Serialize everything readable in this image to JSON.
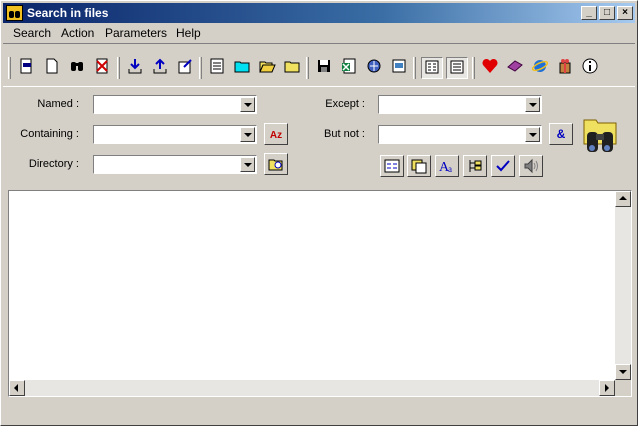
{
  "window": {
    "title": "Search in files"
  },
  "titlebar_buttons": {
    "minimize": "_",
    "maximize": "□",
    "close": "×"
  },
  "menu": {
    "items": [
      "Search",
      "Action",
      "Parameters",
      "Help"
    ]
  },
  "toolbar": {
    "icons": [
      "new-search-icon",
      "new-document-icon",
      "find-binoculars-icon",
      "clear-results-icon",
      "import-icon",
      "export-icon",
      "export-edit-icon",
      "report-icon",
      "folder-cyan-icon",
      "folder-open-icon",
      "folder-icon",
      "save-icon",
      "excel-export-icon",
      "network-search-icon",
      "zip-search-icon",
      "detail-view-icon",
      "list-view-icon",
      "favorite-heart-icon",
      "book-icon",
      "internet-explorer-icon",
      "gift-icon",
      "info-icon"
    ],
    "colors": {
      "heart": "#e00000",
      "book": "#a040a0",
      "ie": "#1e70d8",
      "arrow": "#0000c0"
    }
  },
  "form": {
    "named_label": "Named :",
    "containing_label": "Containing :",
    "directory_label": "Directory :",
    "except_label": "Except :",
    "butnot_label": "But not :",
    "named_value": "",
    "containing_value": "",
    "directory_value": "",
    "except_value": "",
    "butnot_value": "",
    "case_button_text": "Az",
    "and_button_text": "&"
  },
  "options": {
    "icons": [
      "encoding-icon",
      "copy-files-icon",
      "font-case-icon",
      "tree-icon",
      "check-icon",
      "sound-icon"
    ]
  }
}
